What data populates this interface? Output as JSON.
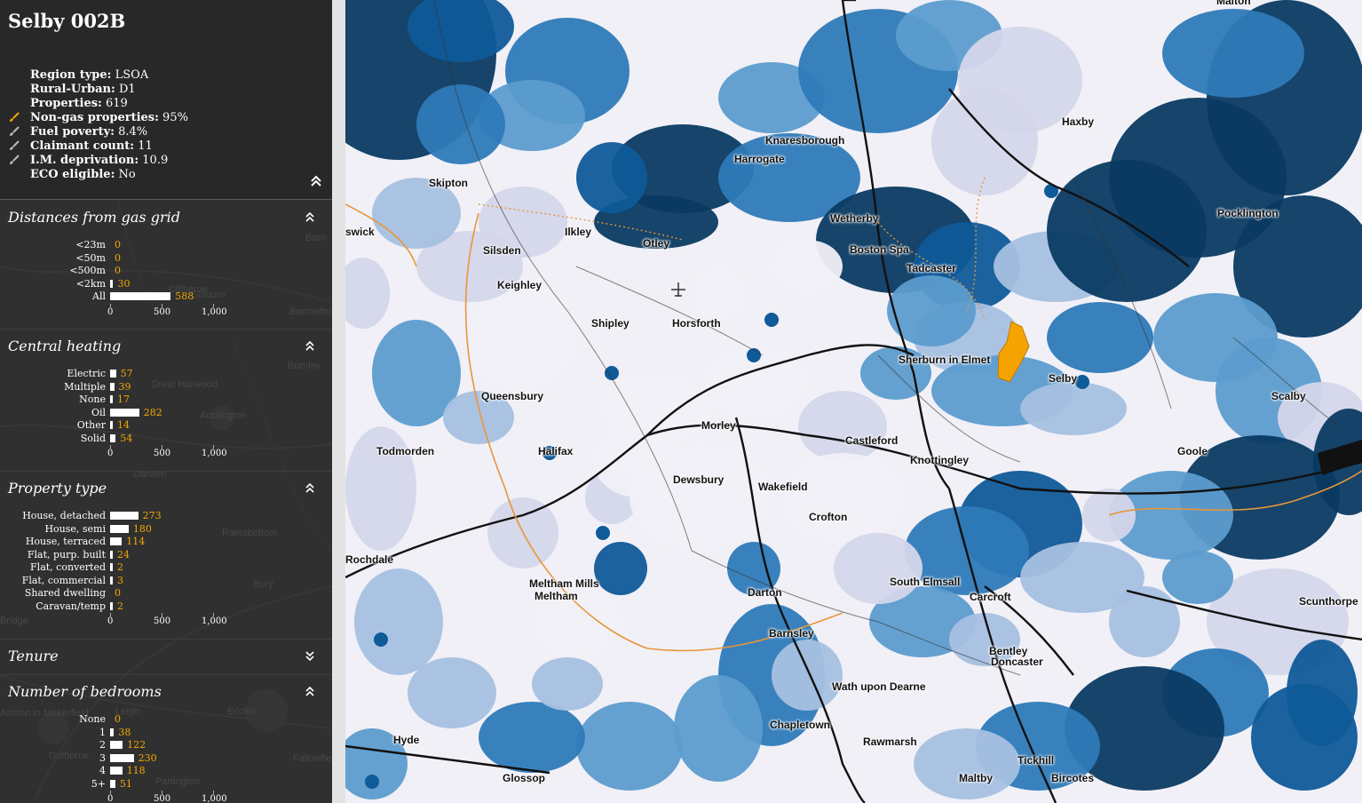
{
  "panel": {
    "title": "Selby 002B",
    "stats": [
      {
        "label": "Region type:",
        "value": "LSOA",
        "brush": false
      },
      {
        "label": "Rural-Urban:",
        "value": "D1",
        "brush": false
      },
      {
        "label": "Properties:",
        "value": "619",
        "brush": false
      },
      {
        "label": "Non-gas properties:",
        "value": "95%",
        "brush": true,
        "active": true
      },
      {
        "label": "Fuel poverty:",
        "value": "8.4%",
        "brush": true
      },
      {
        "label": "Claimant count:",
        "value": "11",
        "brush": true
      },
      {
        "label": "I.M. deprivation:",
        "value": "10.9",
        "brush": true
      },
      {
        "label": "ECO eligible:",
        "value": "No",
        "brush": false
      }
    ],
    "axis_ticks": [
      "0",
      "500",
      "1,000"
    ],
    "axis_max": 1000,
    "sections": [
      {
        "title": "Distances from gas grid",
        "state": "expanded",
        "rows": [
          {
            "label": "<23m",
            "value": 0
          },
          {
            "label": "<50m",
            "value": 0
          },
          {
            "label": "<500m",
            "value": 0
          },
          {
            "label": "<2km",
            "value": 30
          },
          {
            "label": "All",
            "value": 588
          }
        ]
      },
      {
        "title": "Central heating",
        "state": "expanded",
        "rows": [
          {
            "label": "Electric",
            "value": 57
          },
          {
            "label": "Multiple",
            "value": 39
          },
          {
            "label": "None",
            "value": 17
          },
          {
            "label": "Oil",
            "value": 282
          },
          {
            "label": "Other",
            "value": 14
          },
          {
            "label": "Solid",
            "value": 54
          }
        ]
      },
      {
        "title": "Property type",
        "state": "expanded",
        "rows": [
          {
            "label": "House, detached",
            "value": 273
          },
          {
            "label": "House, semi",
            "value": 180
          },
          {
            "label": "House, terraced",
            "value": 114
          },
          {
            "label": "Flat, purp. built",
            "value": 24
          },
          {
            "label": "Flat, converted",
            "value": 2
          },
          {
            "label": "Flat, commercial",
            "value": 3
          },
          {
            "label": "Shared dwelling",
            "value": 0
          },
          {
            "label": "Caravan/temp",
            "value": 2
          }
        ]
      },
      {
        "title": "Tenure",
        "state": "collapsed",
        "rows": []
      },
      {
        "title": "Number of bedrooms",
        "state": "expanded",
        "rows": [
          {
            "label": "None",
            "value": 0
          },
          {
            "label": "1",
            "value": 38
          },
          {
            "label": "2",
            "value": 122
          },
          {
            "label": "3",
            "value": 230
          },
          {
            "label": "4",
            "value": 118
          },
          {
            "label": "5+",
            "value": 51
          }
        ]
      }
    ],
    "ghost_places": [
      "Barn",
      "Gisburn",
      "Barrowford",
      "Burnley",
      "Great Harwood",
      "Accrington",
      "Darwen",
      "Ramsbottom",
      "Bury",
      "Bridge",
      "Eccles",
      "Golborne",
      "Leigh",
      "Ashton in Makerfield",
      "Fallowfield",
      "Partington",
      "Clitheroe"
    ]
  },
  "map": {
    "selected_color": "#f5a300",
    "choropleth_colors": [
      "#f1f0f7",
      "#d4d6ea",
      "#a6c0e0",
      "#5c9ccd",
      "#2e7ab8",
      "#0f5a99",
      "#0a3a62"
    ],
    "towns": [
      "Haxby",
      "Knaresborough",
      "Harrogate",
      "Skipton",
      "Wetherby",
      "Pocklington",
      "Ilkley",
      "Silsden",
      "Otley",
      "Boston Spa",
      "Tadcaster",
      "Keighley",
      "Shipley",
      "Horsforth",
      "Sherburn in Elmet",
      "Selby",
      "Queensbury",
      "Scalby",
      "Morley",
      "Castleford",
      "Goole",
      "Todmorden",
      "Halifax",
      "Knottingley",
      "Dewsbury",
      "Wakefield",
      "Crofton",
      "Rochdale",
      "South Elmsall",
      "Meltham Mills",
      "Meltham",
      "Darton",
      "Carcroft",
      "Scunthorpe",
      "Barnsley",
      "Bentley",
      "Doncaster",
      "Wath upon Dearne",
      "Chapletown",
      "Rawmarsh",
      "Hyde",
      "Tickhill",
      "Glossop",
      "Maltby",
      "Bircotes",
      "Malton",
      "swick"
    ]
  }
}
